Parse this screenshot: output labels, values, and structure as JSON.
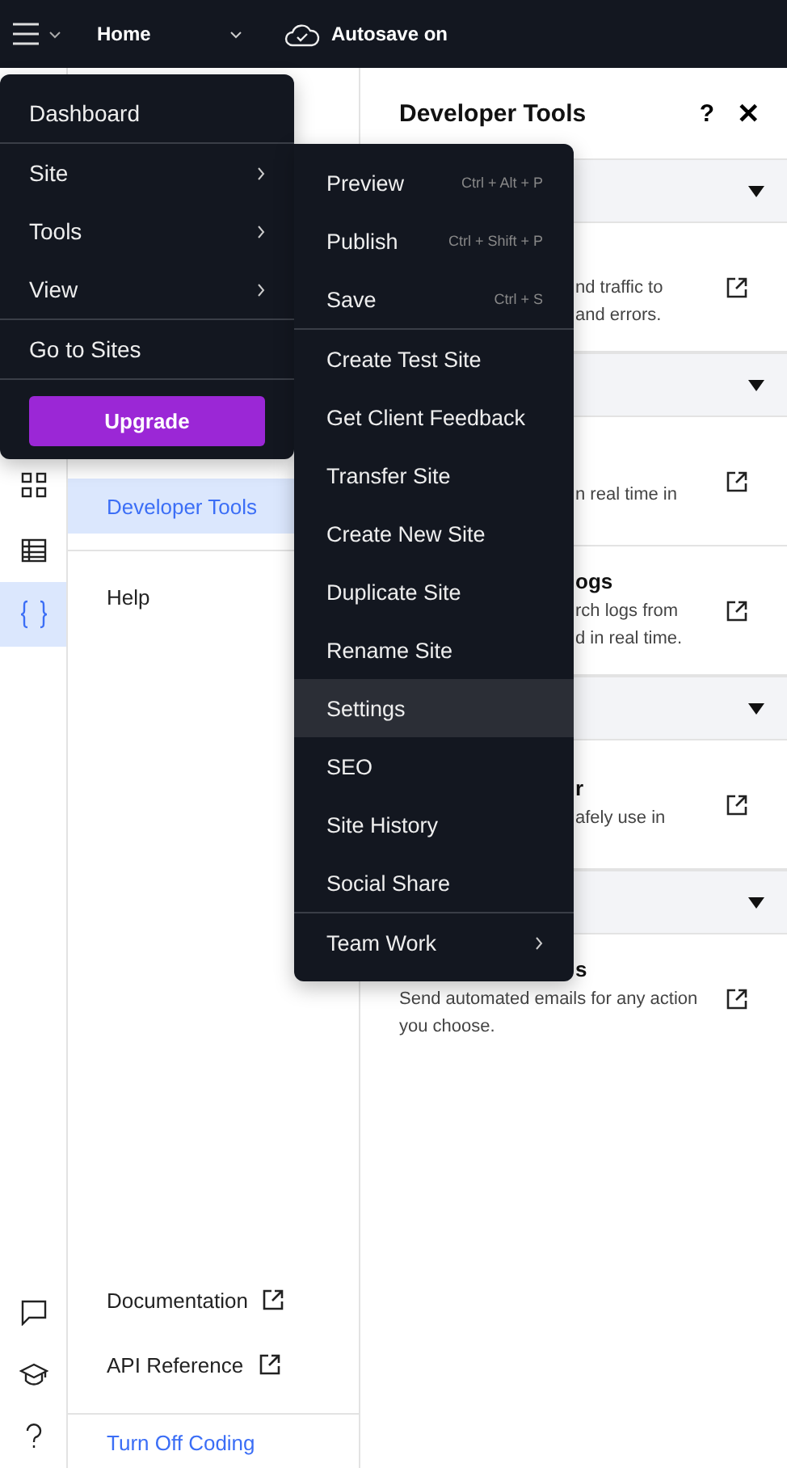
{
  "top_bar": {
    "page": "Home",
    "autosave": "Autosave on"
  },
  "rail": {
    "top_icons": [
      {
        "kind": "grid",
        "selected": false
      },
      {
        "kind": "table",
        "selected": false
      },
      {
        "kind": "code",
        "selected": true
      }
    ],
    "bottom_icons": [
      {
        "kind": "chat"
      },
      {
        "kind": "learn"
      },
      {
        "kind": "help"
      }
    ]
  },
  "nav": {
    "items": [
      {
        "label": "Developer Tools",
        "selected": true
      },
      {
        "label": "Help",
        "selected": false
      }
    ],
    "links": [
      {
        "label": "Documentation",
        "external": true
      },
      {
        "label": "API Reference",
        "external": true
      }
    ],
    "footer_link": "Turn Off Coding"
  },
  "panel": {
    "title": "Developer Tools",
    "help": "?",
    "close": "✕",
    "sections": [
      {
        "items": [
          {
            "kind": "partial",
            "description": "nd traffic to\nand errors."
          }
        ]
      },
      {
        "items": [
          {
            "kind": "partial",
            "description": "n real time in"
          },
          {
            "kind": "partial",
            "title": "ogs",
            "description": "rch logs from\nd in real time."
          }
        ]
      },
      {
        "items": [
          {
            "kind": "partial",
            "title": "r",
            "description": "afely use in"
          }
        ]
      },
      {
        "items": [
          {
            "kind": "title_partial",
            "title": "s",
            "description": "Send automated emails for any action you choose."
          }
        ]
      }
    ]
  },
  "main_menu": {
    "items": [
      {
        "label": "Dashboard",
        "submenu": false,
        "divider_after": true
      },
      {
        "label": "Site",
        "submenu": true,
        "divider_after": false
      },
      {
        "label": "Tools",
        "submenu": true,
        "divider_after": false
      },
      {
        "label": "View",
        "submenu": true,
        "divider_after": true
      },
      {
        "label": "Go to Sites",
        "submenu": false,
        "divider_after": true
      }
    ],
    "upgrade": "Upgrade"
  },
  "site_menu": {
    "items": [
      {
        "label": "Preview",
        "shortcut": "Ctrl + Alt + P",
        "selected": false,
        "submenu": false,
        "divider_after": false
      },
      {
        "label": "Publish",
        "shortcut": "Ctrl + Shift + P",
        "selected": false,
        "submenu": false,
        "divider_after": false
      },
      {
        "label": "Save",
        "shortcut": "Ctrl + S",
        "selected": false,
        "submenu": false,
        "divider_after": true
      },
      {
        "label": "Create Test Site",
        "selected": false,
        "submenu": false,
        "divider_after": false
      },
      {
        "label": "Get Client Feedback",
        "selected": false,
        "submenu": false,
        "divider_after": false
      },
      {
        "label": "Transfer Site",
        "selected": false,
        "submenu": false,
        "divider_after": false
      },
      {
        "label": "Create New Site",
        "selected": false,
        "submenu": false,
        "divider_after": false
      },
      {
        "label": "Duplicate Site",
        "selected": false,
        "submenu": false,
        "divider_after": false
      },
      {
        "label": "Rename Site",
        "selected": false,
        "submenu": false,
        "divider_after": false
      },
      {
        "label": "Settings",
        "selected": true,
        "submenu": false,
        "divider_after": false
      },
      {
        "label": "SEO",
        "selected": false,
        "submenu": false,
        "divider_after": false
      },
      {
        "label": "Site History",
        "selected": false,
        "submenu": false,
        "divider_after": false
      },
      {
        "label": "Social Share",
        "selected": false,
        "submenu": false,
        "divider_after": true
      },
      {
        "label": "Team Work",
        "selected": false,
        "submenu": true,
        "divider_after": false
      }
    ]
  }
}
